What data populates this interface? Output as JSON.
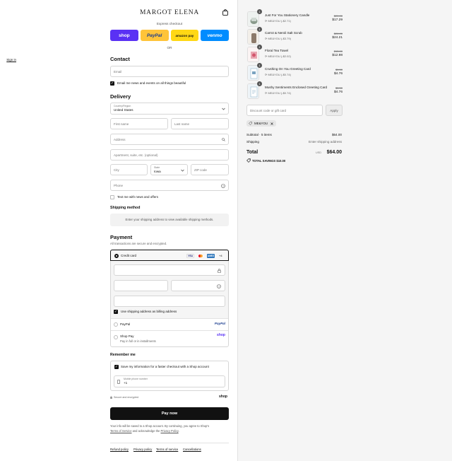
{
  "brand": {
    "name": "MARGOT ELENA"
  },
  "express": {
    "label": "Express checkout",
    "buttons": [
      {
        "label": "shop",
        "color": "#5a31f4"
      },
      {
        "label": "PayPal",
        "color": "#ffc439"
      },
      {
        "label": "amazon pay",
        "color": "#ffd814"
      },
      {
        "label": "venmo",
        "color": "#008cff"
      }
    ],
    "or_label": "OR"
  },
  "contact": {
    "title": "Contact",
    "signin": "Sign in",
    "email_placeholder": "Email",
    "news_label": "Email me news and events on all things beautiful"
  },
  "delivery": {
    "title": "Delivery",
    "country_label": "Country/Region",
    "country_value": "United States",
    "first_name_placeholder": "First name",
    "last_name_placeholder": "Last name",
    "address_placeholder": "Address",
    "apartment_placeholder": "Apartment, suite, etc. (optional)",
    "city_placeholder": "City",
    "state_label": "State",
    "state_value": "Iowa",
    "zip_placeholder": "ZIP code",
    "phone_placeholder": "Phone",
    "text_me_label": "Text me with news and offers"
  },
  "shipping_method": {
    "title": "Shipping method",
    "message": "Enter your shipping address to view available shipping methods."
  },
  "payment": {
    "title": "Payment",
    "subtitle": "All transactions are secure and encrypted.",
    "credit_card_label": "Credit card",
    "card_badges": [
      {
        "label": "VISA",
        "color": "#1a1f71"
      },
      {
        "label": "MC",
        "color": "#eb001b"
      },
      {
        "label": "AMEX",
        "color": "#2e77bb"
      }
    ],
    "more_cards": "+4",
    "billing_label": "Use shipping address as billing address",
    "paypal_label": "PayPal",
    "paypal_logo": "PayPal",
    "shoppay_label": "Shop Pay",
    "shoppay_sub": "Pay in full or in installments",
    "shoppay_logo": "shop"
  },
  "remember": {
    "title": "Remember me",
    "save_label": "Save my information for a faster checkout with a Shop account",
    "phone_label": "Mobile phone number",
    "phone_value": "+1",
    "secure_label": "Secure and encrypted",
    "shop_logo": "shop"
  },
  "paynow": {
    "label": "Pay now"
  },
  "legal": {
    "line1": "Your info will be saved to a Shop account. By continuing, you agree to Shop's",
    "terms": "Terms of Service",
    "and_ack": "and acknowledge the",
    "privacy": "Privacy Policy",
    "period": "."
  },
  "footer": {
    "links": [
      "Refund policy",
      "Privacy policy",
      "Terms of service",
      "Cancellations"
    ]
  },
  "cart": {
    "items": [
      {
        "qty": "1",
        "name": "Just For You Stationery Candle",
        "discount": "ME&YOU (-$2.71)",
        "old": "$20.00",
        "new": "$17.29"
      },
      {
        "qty": "1",
        "name": "Carrot & Neroli Salt Scrub",
        "discount": "ME&YOU (-$3.79)",
        "old": "$28.00",
        "new": "$24.21"
      },
      {
        "qty": "1",
        "name": "Floral Tea Towel",
        "discount": "ME&YOU (-$2.02)",
        "old": "$15.00",
        "new": "$12.98"
      },
      {
        "qty": "1",
        "name": "Crushing On You Greeting Card",
        "discount": "ME&YOU (-$0.74)",
        "old": "$5.50",
        "new": "$4.76"
      },
      {
        "qty": "1",
        "name": "Mushy Sentiments Enclosed Greeting Card",
        "discount": "ME&YOU (-$0.74)",
        "old": "$5.50",
        "new": "$4.76"
      }
    ],
    "discount_placeholder": "Discount code or gift card",
    "apply_label": "Apply",
    "applied_code": "ME&YOU",
    "subtotal_label": "Subtotal · 5 items",
    "subtotal_value": "$64.00",
    "shipping_label": "Shipping",
    "shipping_value": "Enter shipping address",
    "total_label": "Total",
    "currency": "USD",
    "total_value": "$64.00",
    "savings_label": "TOTAL SAVINGS",
    "savings_value": "$10.00"
  }
}
